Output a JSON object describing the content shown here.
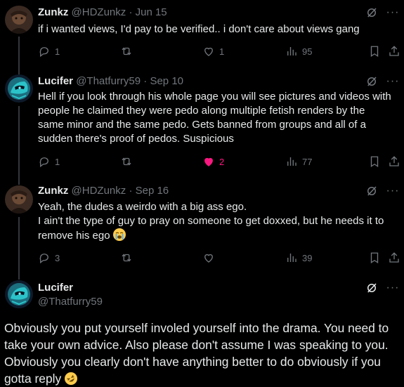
{
  "tweets": [
    {
      "name": "Zunkz",
      "handle": "@HDZunkz",
      "date": "· Jun 15",
      "lines": [
        "if i wanted views, I'd pay to be verified.. i don't care about views gang"
      ],
      "replies": "1",
      "reposts": "",
      "likes": "1",
      "views": "95",
      "liked": false
    },
    {
      "name": "Lucifer",
      "handle": "@Thatfurry59",
      "date": "· Sep 10",
      "lines": [
        "Hell if you look through his whole page you will see pictures and videos with",
        "people he claimed they were pedo along multiple fetish renders by the",
        "same minor and the same pedo. Gets banned from groups and all of a",
        "sudden there's proof of pedos. Suspicious"
      ],
      "replies": "1",
      "reposts": "",
      "likes": "2",
      "views": "77",
      "liked": true
    },
    {
      "name": "Zunkz",
      "handle": "@HDZunkz",
      "date": "· Sep 16",
      "lines": [
        "Yeah, the dudes a weirdo with a big ass ego.",
        "I ain't the type of guy to pray on someone to get doxxed, but he needs it to",
        "remove his ego"
      ],
      "replies": "3",
      "reposts": "",
      "likes": "",
      "views": "39",
      "liked": false,
      "emoji_end": "loudly-crying-face-emoji"
    }
  ],
  "main": {
    "name": "Lucifer",
    "handle": "@Thatfurry59",
    "lines": [
      "Obviously you put yourself involed yourself into the drama. You need to",
      "take your own advice. Also please don't assume I was speaking to you.",
      "Obviously you clearly don't have anything better to do obviously if you",
      "gotta reply"
    ],
    "emoji_end": "rolling-on-floor-laughing-emoji"
  },
  "ui": {
    "more_label": "···"
  },
  "colors": {
    "background": "#000000",
    "text": "#e7e9ea",
    "muted": "#71767b",
    "like": "#f91880"
  }
}
